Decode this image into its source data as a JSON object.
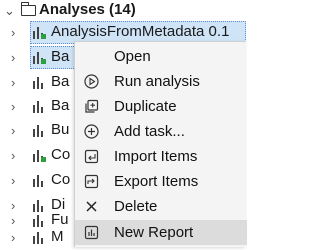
{
  "tree": {
    "header_label": "Analyses (14)",
    "rows": [
      {
        "label": "AnalysisFromMetadata 0.1",
        "icon": "analysis-icon",
        "green": true
      },
      {
        "label": "Ba",
        "icon": "analysis-icon",
        "green": true
      },
      {
        "label": "Ba",
        "icon": "analysis-icon",
        "green": false
      },
      {
        "label": "Ba",
        "icon": "analysis-icon",
        "green": false
      },
      {
        "label": "Bu",
        "icon": "analysis-icon",
        "green": false
      },
      {
        "label": "Co",
        "icon": "analysis-icon",
        "green": true
      },
      {
        "label": "Co",
        "icon": "analysis-icon",
        "green": false
      },
      {
        "label": "Di",
        "icon": "analysis-icon",
        "green": false
      },
      {
        "label": "Fu",
        "icon": "analysis-icon",
        "green": false
      },
      {
        "label": "M",
        "icon": "analysis-icon",
        "green": false
      }
    ]
  },
  "context_menu": {
    "items": [
      {
        "label": "Open",
        "icon": ""
      },
      {
        "label": "Run analysis",
        "icon": "play-icon"
      },
      {
        "label": "Duplicate",
        "icon": "duplicate-icon"
      },
      {
        "label": "Add task...",
        "icon": "add-icon"
      },
      {
        "label": "Import Items",
        "icon": "import-icon"
      },
      {
        "label": "Export Items",
        "icon": "export-icon"
      },
      {
        "label": "Delete",
        "icon": "close-icon"
      },
      {
        "label": "New Report",
        "icon": "report-icon"
      }
    ],
    "hovered_item": "New Report"
  },
  "colors": {
    "selection": "#d0e4f8",
    "menu_background": "#f4f4f4",
    "menu_hover": "#dcdcdc",
    "green_marker": "#2e9e3e"
  }
}
